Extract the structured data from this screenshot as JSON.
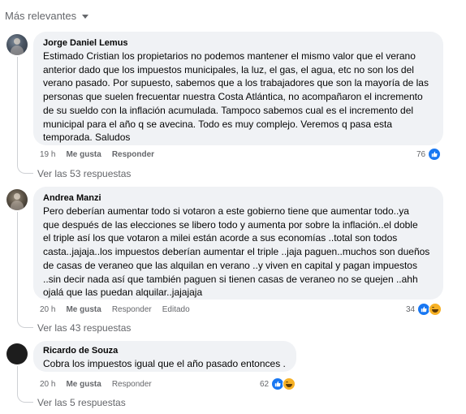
{
  "sort": {
    "label": "Más relevantes"
  },
  "comments": [
    {
      "author": "Jorge Daniel Lemus",
      "lines": [
        "Estimado Cristian los propietarios no podemos mantener el mismo valor que el verano",
        "anterior dado que los impuestos municipales, la luz, el gas, el agua, etc no son los del",
        "verano pasado. Por supuesto, sabemos que a los trabajadores que son la mayoría de las",
        "personas que suelen frecuentar nuestra Costa Atlántica, no acompañaron el incremento",
        "de su sueldo con la inflación acumulada. Tampoco sabemos cual es el incremento del",
        "municipal para el año q se avecina. Todo es muy complejo. Veremos q pasa esta",
        "temporada. Saludos"
      ],
      "time": "19 h",
      "like_label": "Me gusta",
      "reply_label": "Responder",
      "reaction_count": "76",
      "replies_label": "Ver las 53 respuestas"
    },
    {
      "author": "Andrea Manzi",
      "lines": [
        "Pero deberían aumentar todo si votaron a este gobierno tiene que aumentar todo..ya",
        "que después de las elecciones se libero todo y aumenta por sobre la inflación..el doble",
        "el triple así los que votaron a milei están acorde a sus economías ..total son todos",
        "casta..jajaja..los impuestos deberían aumentar el triple ..jaja paguen..muchos son dueños",
        "de casas de veraneo que las alquilan en verano ..y viven en capital y pagan impuestos",
        "..sin decir nada así que también paguen si tienen casas de veraneo no se quejen ..ahh",
        "ojalá que las puedan alquilar..jajajaja"
      ],
      "time": "20 h",
      "like_label": "Me gusta",
      "reply_label": "Responder",
      "edited_label": "Editado",
      "reaction_count": "34",
      "replies_label": "Ver las 43 respuestas"
    },
    {
      "author": "Ricardo de Souza",
      "lines": [
        "Cobra los impuestos igual que el año pasado entonces ."
      ],
      "time": "20 h",
      "like_label": "Me gusta",
      "reply_label": "Responder",
      "reaction_count": "62",
      "replies_label": "Ver las 5 respuestas"
    }
  ],
  "colors": {
    "bubble": "#f0f2f5",
    "secondary_text": "#65676b",
    "like_blue": "#1877f2"
  },
  "icons": {
    "like": "thumbs-up-icon",
    "haha": "haha-emoji-icon",
    "sort": "chevron-down-icon"
  }
}
